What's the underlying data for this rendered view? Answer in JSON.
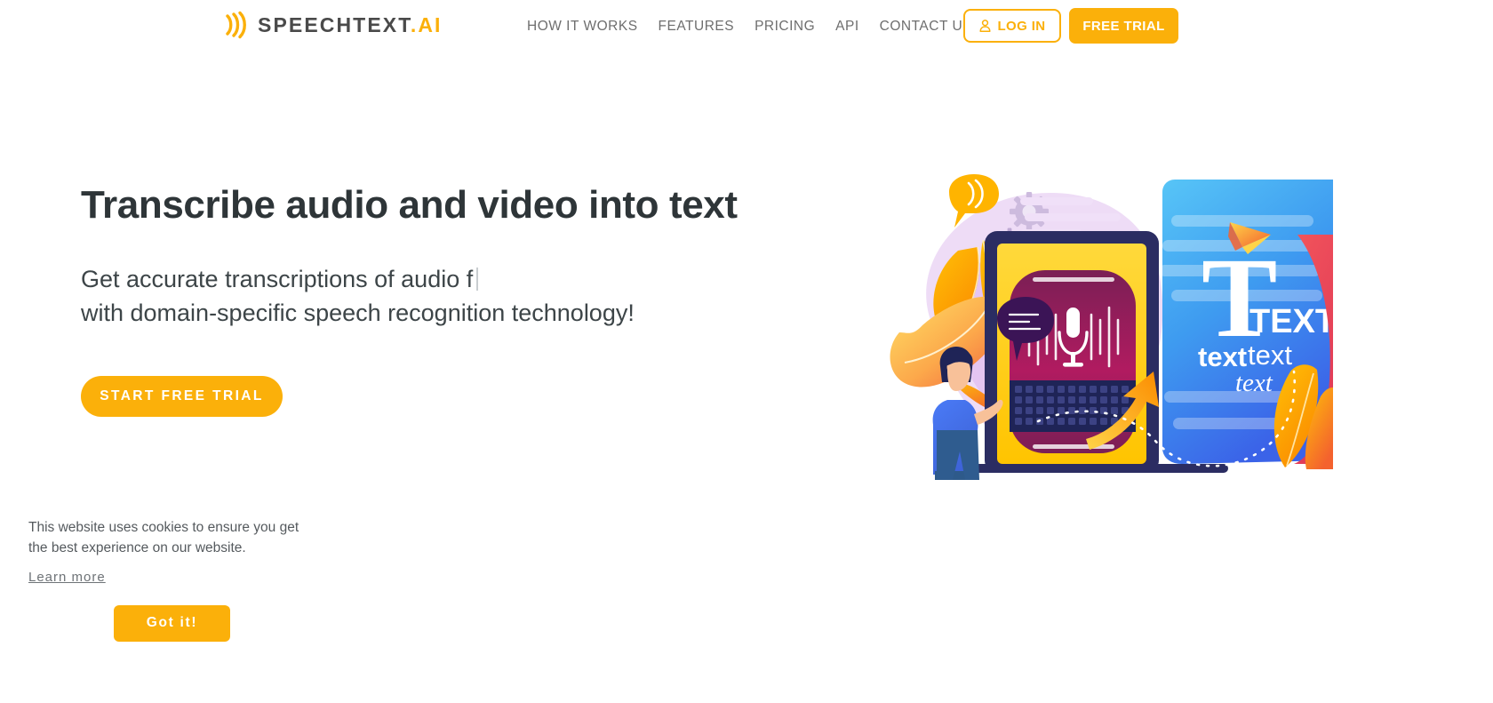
{
  "site": {
    "background_color": "#ffffff",
    "accent_color": "#FBB00A",
    "text_dark": "#2e3538"
  },
  "header": {
    "logo": {
      "icon": "sound-wave-icon",
      "name": "SPEECHTEXT",
      "suffix": ".AI"
    },
    "nav": [
      {
        "label": "HOW IT WORKS",
        "name": "nav-how-it-works"
      },
      {
        "label": "FEATURES",
        "name": "nav-features"
      },
      {
        "label": "PRICING",
        "name": "nav-pricing"
      },
      {
        "label": "API",
        "name": "nav-api"
      },
      {
        "label": "CONTACT US",
        "name": "nav-contact-us"
      }
    ],
    "login_button": {
      "label": "LOG IN",
      "icon": "user-icon",
      "text_color": "#FBB00A",
      "border_color": "#FBB00A"
    },
    "free_trial_button": {
      "label": "FREE TRIAL",
      "background_color": "#FBB00A",
      "text_color": "#ffffff"
    }
  },
  "hero": {
    "title": "Transcribe audio and video into text",
    "subtitle_line1": "Get accurate transcriptions of audio f",
    "subtitle_line2": "with domain-specific speech recognition technology!",
    "cta_button": {
      "label": "START FREE TRIAL",
      "background_color": "#FBB00A",
      "text_color": "#ffffff"
    },
    "illustration": {
      "name": "speech-to-text-illustration",
      "document_big_letter": "T",
      "document_word_bold": "TEXT",
      "document_word_small_bold": "text",
      "document_word_regular": "text",
      "document_word_italic": "text",
      "elements": [
        "purple-blob-background",
        "orange-leaves",
        "speech-bubble-orange",
        "speech-bubble-dark",
        "gears-icon",
        "laptop-device",
        "microphone-icon",
        "sound-wave-bars",
        "keyboard",
        "person-figure",
        "paper-plane-icon",
        "orange-arrow",
        "dotted-path",
        "blue-document-card"
      ]
    }
  },
  "cookie_banner": {
    "message": "This website uses cookies to ensure you get the best experience on our website.",
    "learn_more_label": "Learn more",
    "accept_label": "Got it!",
    "accept_background_color": "#FBB00A"
  }
}
